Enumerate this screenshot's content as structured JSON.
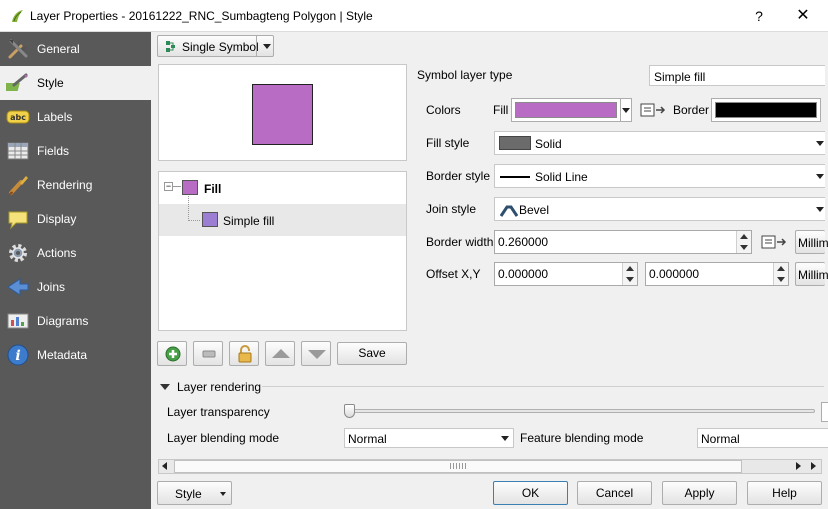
{
  "window": {
    "title": "Layer Properties - 20161222_RNC_Sumbagteng Polygon | Style",
    "help_glyph": "?",
    "close_glyph": "✕"
  },
  "sidebar": {
    "items": [
      {
        "label": "General",
        "icon": "tools-icon"
      },
      {
        "label": "Style",
        "icon": "paintbrush-icon",
        "active": true
      },
      {
        "label": "Labels",
        "icon": "abc-label-icon"
      },
      {
        "label": "Fields",
        "icon": "table-icon"
      },
      {
        "label": "Rendering",
        "icon": "brush-icon"
      },
      {
        "label": "Display",
        "icon": "speech-bubble-icon"
      },
      {
        "label": "Actions",
        "icon": "gear-icon"
      },
      {
        "label": "Joins",
        "icon": "join-arrow-icon"
      },
      {
        "label": "Diagrams",
        "icon": "diagram-icon"
      },
      {
        "label": "Metadata",
        "icon": "info-icon"
      }
    ]
  },
  "renderer": {
    "type_label": "Single Symbol"
  },
  "symbol_tree": {
    "root": "Fill",
    "child": "Simple fill"
  },
  "toolbar": {
    "save_label": "Save"
  },
  "symbol_layer": {
    "type_label": "Symbol layer type",
    "type_value": "Simple fill",
    "colors_label": "Colors",
    "fill_label": "Fill",
    "border_label": "Border",
    "fill_style_label": "Fill style",
    "fill_style_value": "Solid",
    "border_style_label": "Border style",
    "border_style_value": "Solid Line",
    "join_style_label": "Join style",
    "join_style_value": "Bevel",
    "border_width_label": "Border width",
    "border_width_value": "0.260000",
    "border_width_unit": "Millim",
    "offset_label": "Offset X,Y",
    "offset_x": "0.000000",
    "offset_y": "0.000000",
    "offset_unit": "Millim"
  },
  "layer_rendering": {
    "header": "Layer rendering",
    "transparency_label": "Layer transparency",
    "transparency_value": 0,
    "blending_label": "Layer blending mode",
    "blending_value": "Normal",
    "feature_blending_label": "Feature blending mode",
    "feature_blending_value": "Normal"
  },
  "footer": {
    "style_label": "Style",
    "ok_label": "OK",
    "cancel_label": "Cancel",
    "apply_label": "Apply",
    "help_label": "Help"
  },
  "colors": {
    "fill": "#b86cc4",
    "border": "#000000",
    "swatch_preview": "#b86cc4",
    "tree_swatch": "#9c7fd2",
    "sidebar_bg": "#595959",
    "fill_style_swatch": "#6b6b6b"
  }
}
